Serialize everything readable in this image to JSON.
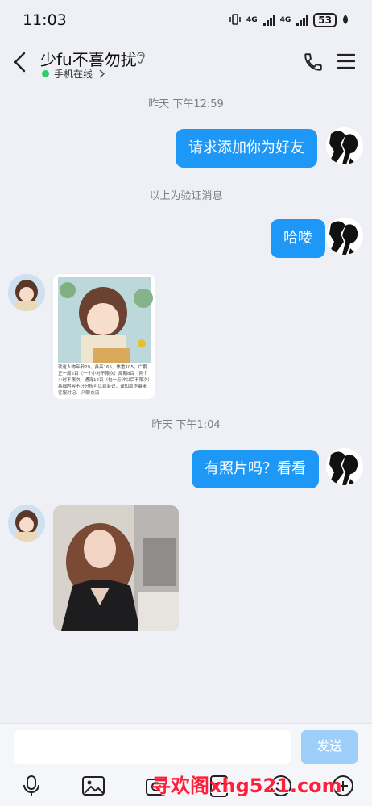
{
  "status": {
    "time": "11:03",
    "net1": "4G",
    "net2": "4G",
    "battery": "53"
  },
  "header": {
    "title": "少fu不喜勿扰",
    "subtitle": "手机在线"
  },
  "chat": {
    "ts1": "昨天 下午12:59",
    "msg1": "请求添加你为好友",
    "note": "以上为验证消息",
    "msg2": "哈喽",
    "card_caption": "就这人物年龄29，身高165，体重105，广鹏正一周5百（一个小时不限次）周期8百（两个小时不限次）通宵12百（包一点钟以后不限次）基础内容不计分析可以到会议，谁知那诈骗来客服对记。 闪聊交流",
    "ts2": "昨天 下午1:04",
    "msg3": "有照片吗？看看"
  },
  "input": {
    "placeholder": "",
    "send": "发送"
  },
  "watermark": "寻欢阁xhg521.com",
  "colors": {
    "bubble": "#1d98f7",
    "send_disabled": "#9dcffa",
    "online": "#2bd166",
    "watermark": "#ff1f3a"
  }
}
